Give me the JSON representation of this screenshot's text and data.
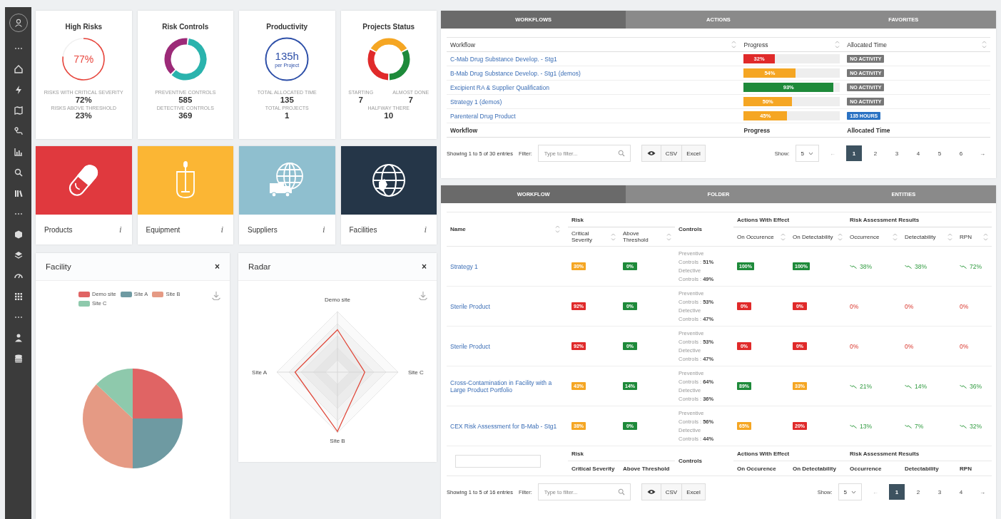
{
  "kpis": [
    {
      "kind": "gauge",
      "title": "High Risks",
      "center": "77%",
      "color": "#e8453c",
      "stats": [
        {
          "label": "RISKS WITH CRITICAL SEVERITY",
          "value": "72%"
        },
        {
          "label": "RISKS ABOVE THRESHOLD",
          "value": "23%"
        }
      ]
    },
    {
      "kind": "donut",
      "title": "Risk Controls",
      "segments": [
        {
          "color": "#2ab3ad"
        },
        {
          "color": "#9c2a78"
        }
      ],
      "stats": [
        {
          "label": "PREVENTIVE CONTROLS",
          "value": "585"
        },
        {
          "label": "DETECTIVE CONTROLS",
          "value": "369"
        }
      ]
    },
    {
      "kind": "ring",
      "title": "Productivity",
      "center": "135h",
      "sub": "per Project",
      "color": "#2d4fa8",
      "stats": [
        {
          "label": "TOTAL ALLOCATED TIME",
          "value": "135"
        },
        {
          "label": "TOTAL PROJECTS",
          "value": "1"
        }
      ]
    },
    {
      "kind": "status",
      "title": "Projects Status",
      "segments": [
        {
          "color": "#f5a623"
        },
        {
          "color": "#1e8a3a"
        },
        {
          "color": "#e02a2a"
        }
      ],
      "stats": [
        {
          "label": "STARTING",
          "value": "7"
        },
        {
          "label": "ALMOST DONE",
          "value": "7"
        },
        {
          "label": "HALFWAY THERE",
          "value": "10"
        }
      ]
    }
  ],
  "tiles": [
    {
      "kind": "pill",
      "label": "Products",
      "info": "i",
      "color": "#e0393e"
    },
    {
      "kind": "vessel",
      "label": "Equipment",
      "info": "i",
      "color": "#fbb634"
    },
    {
      "kind": "globe-truck",
      "label": "Suppliers",
      "info": "i",
      "color": "#8fbfcf"
    },
    {
      "kind": "globe",
      "label": "Facilities",
      "info": "i",
      "color": "#253648"
    }
  ],
  "facility_panel": {
    "title": "Facility",
    "close": "×",
    "legend": [
      {
        "label": "Demo site",
        "color": "#e06464"
      },
      {
        "label": "Site A",
        "color": "#6e9aa2"
      },
      {
        "label": "Site B",
        "color": "#e59a84"
      },
      {
        "label": "Site C",
        "color": "#8ec9ac"
      }
    ]
  },
  "radar_panel": {
    "title": "Radar",
    "close": "×",
    "axes": [
      "Demo site",
      "Site C",
      "Site B",
      "Site A"
    ]
  },
  "workflow_table": {
    "tabs": [
      {
        "label": "WORKFLOWS",
        "selected": true
      },
      {
        "label": "ACTIONS",
        "selected": false
      },
      {
        "label": "FAVORITES",
        "selected": false
      }
    ],
    "columns": [
      "Workflow",
      "Progress",
      "Allocated Time"
    ],
    "rows": [
      {
        "workflow": "C-Mab Drug Substance Develop. - Stg1",
        "progress": "32%",
        "level": 0.32,
        "color": "#e02a2a",
        "time": {
          "text": "NO ACTIVITY",
          "color": "#777777"
        }
      },
      {
        "workflow": "B-Mab Drug Substance Develop. - Stg1 (demos)",
        "progress": "54%",
        "level": 0.54,
        "color": "#f5a623",
        "time": {
          "text": "NO ACTIVITY",
          "color": "#777777"
        }
      },
      {
        "workflow": "Excipient RA & Supplier Qualification",
        "progress": "93%",
        "level": 0.93,
        "color": "#1e8a3a",
        "time": {
          "text": "NO ACTIVITY",
          "color": "#777777"
        }
      },
      {
        "workflow": "Strategy 1 (demos)",
        "progress": "50%",
        "level": 0.5,
        "color": "#f5a623",
        "time": {
          "text": "NO ACTIVITY",
          "color": "#777777"
        }
      },
      {
        "workflow": "Parenteral Drug Product",
        "progress": "45%",
        "level": 0.45,
        "color": "#f5a623",
        "time": {
          "text": "135 HOURS",
          "color": "#2a72c3"
        }
      }
    ],
    "footer": [
      "Workflow",
      "Progress",
      "Allocated Time"
    ],
    "pager": {
      "info": "Showing 1 to 5 of 30 entries",
      "filter_label": "Filter:",
      "placeholder": "Type to filter...",
      "buttons": [
        "CSV",
        "Excel"
      ],
      "show_label": "Show:",
      "show_value": "5",
      "prev": "←",
      "next": "→",
      "pages": [
        {
          "label": "1",
          "selected": true
        },
        {
          "label": "2",
          "selected": false
        },
        {
          "label": "3",
          "selected": false
        },
        {
          "label": "4",
          "selected": false
        },
        {
          "label": "5",
          "selected": false
        },
        {
          "label": "6",
          "selected": false
        }
      ]
    }
  },
  "risk_table": {
    "tabs": [
      {
        "label": "WORKFLOW",
        "selected": true
      },
      {
        "label": "FOLDER",
        "selected": false
      },
      {
        "label": "ENTITIES",
        "selected": false
      }
    ],
    "header": {
      "name": "Name",
      "risk": "Risk",
      "critical": "Critical Severity",
      "above": "Above Threshold",
      "controls": "Controls",
      "actions": "Actions With Effect",
      "on_occ": "On Occurence",
      "on_det": "On Detectability",
      "results": "Risk Assessment Results",
      "occurrence": "Occurrence",
      "detectability": "Detectability",
      "rpn": "RPN"
    },
    "rows": [
      {
        "name": "Strategy 1",
        "critical": {
          "text": "30%",
          "color": "#f5a623"
        },
        "above": {
          "text": "0%",
          "color": "#1e8a3a"
        },
        "controls": [
          "Preventive Controls : **51%**",
          "Detective Controls : **49%**"
        ],
        "on_occ": {
          "text": "100%",
          "color": "#1e8a3a"
        },
        "on_det": {
          "text": "100%",
          "color": "#1e8a3a"
        },
        "occurrence": {
          "text": "38%",
          "kind": "good",
          "trend": true
        },
        "detectability": {
          "text": "38%",
          "kind": "good",
          "trend": true
        },
        "rpn": {
          "text": "72%",
          "kind": "good",
          "trend": true
        }
      },
      {
        "name": "Sterile Product",
        "critical": {
          "text": "92%",
          "color": "#e02a2a"
        },
        "above": {
          "text": "0%",
          "color": "#1e8a3a"
        },
        "controls": [
          "Preventive Controls : **53%**",
          "Detective Controls : **47%**"
        ],
        "on_occ": {
          "text": "0%",
          "color": "#e02a2a"
        },
        "on_det": {
          "text": "0%",
          "color": "#e02a2a"
        },
        "occurrence": {
          "text": "0%",
          "kind": "bad",
          "trend": false
        },
        "detectability": {
          "text": "0%",
          "kind": "bad",
          "trend": false
        },
        "rpn": {
          "text": "0%",
          "kind": "bad",
          "trend": false
        }
      },
      {
        "name": "Sterile Product",
        "critical": {
          "text": "92%",
          "color": "#e02a2a"
        },
        "above": {
          "text": "0%",
          "color": "#1e8a3a"
        },
        "controls": [
          "Preventive Controls : **53%**",
          "Detective Controls : **47%**"
        ],
        "on_occ": {
          "text": "0%",
          "color": "#e02a2a"
        },
        "on_det": {
          "text": "0%",
          "color": "#e02a2a"
        },
        "occurrence": {
          "text": "0%",
          "kind": "bad",
          "trend": false
        },
        "detectability": {
          "text": "0%",
          "kind": "bad",
          "trend": false
        },
        "rpn": {
          "text": "0%",
          "kind": "bad",
          "trend": false
        }
      },
      {
        "name": "Cross-Contamination in Facility with a Large Product Portfolio",
        "critical": {
          "text": "43%",
          "color": "#f5a623"
        },
        "above": {
          "text": "14%",
          "color": "#1e8a3a"
        },
        "controls": [
          "Preventive Controls : **64%**",
          "Detective Controls : **36%**"
        ],
        "on_occ": {
          "text": "89%",
          "color": "#1e8a3a"
        },
        "on_det": {
          "text": "33%",
          "color": "#f5a623"
        },
        "occurrence": {
          "text": "21%",
          "kind": "good",
          "trend": true
        },
        "detectability": {
          "text": "14%",
          "kind": "good",
          "trend": true
        },
        "rpn": {
          "text": "36%",
          "kind": "good",
          "trend": true
        }
      },
      {
        "name": "CEX Risk Assessment for B-Mab - Stg1",
        "critical": {
          "text": "38%",
          "color": "#f5a623"
        },
        "above": {
          "text": "0%",
          "color": "#1e8a3a"
        },
        "controls": [
          "Preventive Controls : **56%**",
          "Detective Controls : **44%**"
        ],
        "on_occ": {
          "text": "65%",
          "color": "#f5a623"
        },
        "on_det": {
          "text": "20%",
          "color": "#e02a2a"
        },
        "occurrence": {
          "text": "13%",
          "kind": "good",
          "trend": true
        },
        "detectability": {
          "text": "7%",
          "kind": "good",
          "trend": true
        },
        "rpn": {
          "text": "32%",
          "kind": "good",
          "trend": true
        }
      }
    ],
    "footer": {
      "risk": "Risk",
      "critical": "Critical Severity",
      "above": "Above Threshold",
      "controls": "Controls",
      "actions": "Actions With Effect",
      "on_occ": "On Occurence",
      "on_det": "On Detectability",
      "results": "Risk Assessment Results",
      "occurrence": "Occurrence",
      "detectability": "Detectability",
      "rpn": "RPN"
    },
    "pager": {
      "info": "Showing 1 to 5 of 16 entries",
      "filter_label": "Filter:",
      "placeholder": "Type to filter...",
      "buttons": [
        "CSV",
        "Excel"
      ],
      "show_label": "Show:",
      "show_value": "5",
      "prev": "←",
      "next": "→",
      "pages": [
        {
          "label": "1",
          "selected": true
        },
        {
          "label": "2",
          "selected": false
        },
        {
          "label": "3",
          "selected": false
        },
        {
          "label": "4",
          "selected": false
        }
      ]
    }
  }
}
